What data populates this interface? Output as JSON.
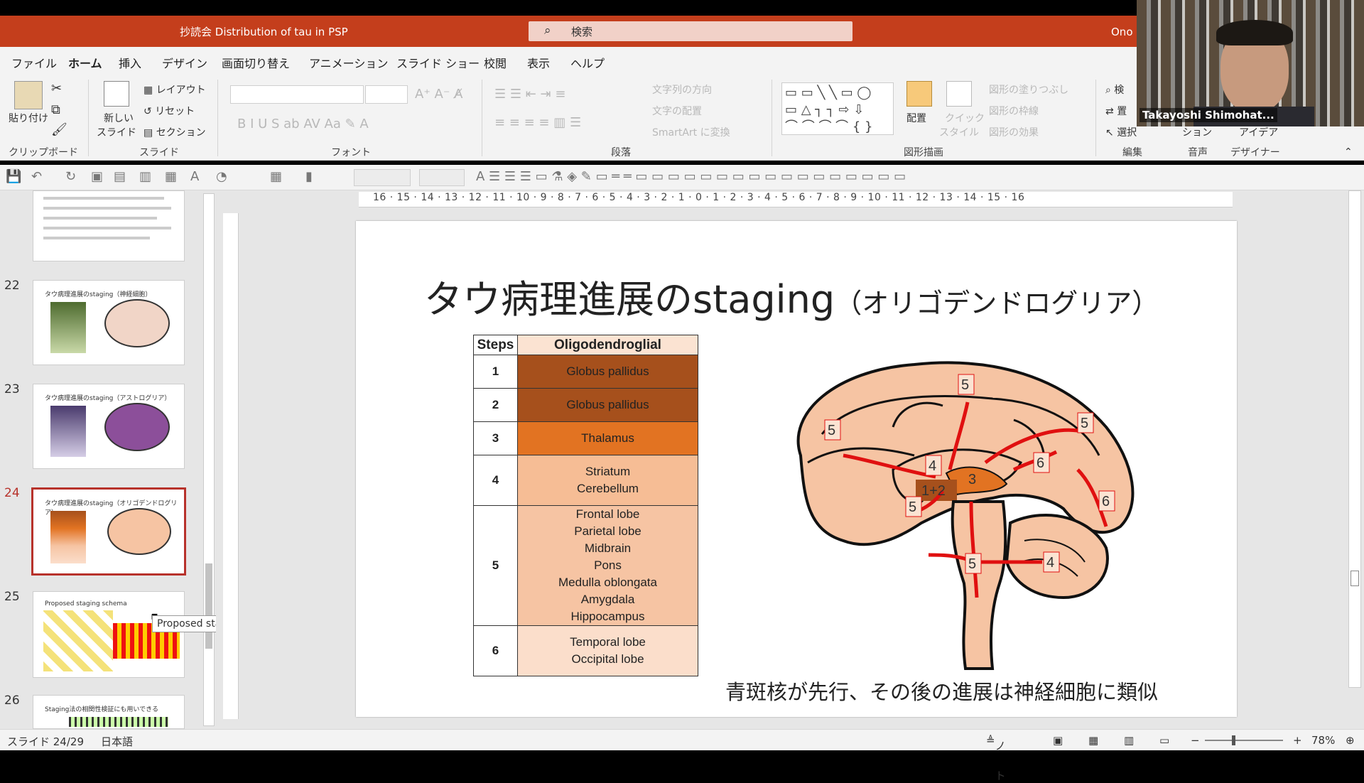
{
  "titlebar": {
    "doc_title": "抄読会 Distribution of tau in PSP",
    "search_placeholder": "検索",
    "user": "Ono"
  },
  "tabs": [
    "ファイル",
    "ホーム",
    "挿入",
    "デザイン",
    "画面切り替え",
    "アニメーション",
    "スライド ショー",
    "校閲",
    "表示",
    "ヘルプ"
  ],
  "ribbon": {
    "clipboard": {
      "paste": "貼り付け",
      "label": "クリップボード"
    },
    "slides": {
      "new_slide": "新しい",
      "new_slide2": "スライド",
      "layout": "レイアウト",
      "reset": "リセット",
      "section": "セクション",
      "label": "スライド"
    },
    "font": {
      "label": "フォント"
    },
    "paragraph": {
      "text_direction": "文字列の方向",
      "align_text": "文字の配置",
      "smartart": "SmartArt に変換",
      "label": "段落"
    },
    "drawing": {
      "arrange": "配置",
      "quick_styles": "クイック",
      "quick_styles2": "スタイル",
      "fill": "図形の塗りつぶし",
      "outline": "図形の枠線",
      "effects": "図形の効果",
      "label": "図形描画"
    },
    "editing": {
      "find": "検",
      "replace": "置",
      "select": "選択",
      "label": "編集"
    },
    "voice": {
      "dictate": "ション",
      "label": "音声"
    },
    "designer": {
      "ideas": "アイデア",
      "label": "デザイナー"
    }
  },
  "thumbnails": [
    {
      "num": "",
      "title": ""
    },
    {
      "num": "22",
      "title": "タウ病理進展のstaging（神経細胞）"
    },
    {
      "num": "23",
      "title": "タウ病理進展のstaging（アストログリア）"
    },
    {
      "num": "24",
      "title": "タウ病理進展のstaging（オリゴデンドログリア）"
    },
    {
      "num": "25",
      "title": "Proposed staging schema"
    },
    {
      "num": "26",
      "title": "Staging法の相関性検証にも用いできる"
    }
  ],
  "tooltip": "Proposed staging schema",
  "ruler_text": "16 · 15 · 14 · 13 · 12 · 11 · 10 · 9 · 8 · 7 · 6 · 5 · 4 · 3 · 2 · 1 · 0 · 1 · 2 · 3 · 4 · 5 · 6 · 7 · 8 · 9 · 10 · 11 · 12 · 13 · 14 · 15 · 16",
  "slide": {
    "title": "タウ病理進展のstaging",
    "title_sub": "（オリゴデンドログリア）",
    "table_headers": [
      "Steps",
      "Oligodendroglial"
    ],
    "rows": [
      {
        "step": "1",
        "regions": "Globus pallidus",
        "color": "#a6501c"
      },
      {
        "step": "2",
        "regions": "Globus pallidus",
        "color": "#a6501c"
      },
      {
        "step": "3",
        "regions": "Thalamus",
        "color": "#e27322"
      },
      {
        "step": "4",
        "regions": "Striatum\nCerebellum",
        "color": "#f6bd95"
      },
      {
        "step": "5",
        "regions": "Frontal lobe\nParietal lobe\nMidbrain\nPons\nMedulla oblongata\nAmygdala\nHippocampus",
        "color": "#f6c4a3"
      },
      {
        "step": "6",
        "regions": "Temporal lobe\nOccipital lobe",
        "color": "#fbdecb"
      }
    ],
    "brain_labels": [
      "5",
      "5",
      "5",
      "4",
      "3",
      "1+2",
      "5",
      "6",
      "6",
      "4",
      "5"
    ],
    "caption": "青斑核が先行、その後の進展は神経細胞に類似"
  },
  "status": {
    "slide_counter": "スライド 24/29",
    "language": "日本語",
    "notes": "ノート",
    "zoom": "78%"
  },
  "webcam": {
    "name": "Takayoshi Shimohat..."
  }
}
